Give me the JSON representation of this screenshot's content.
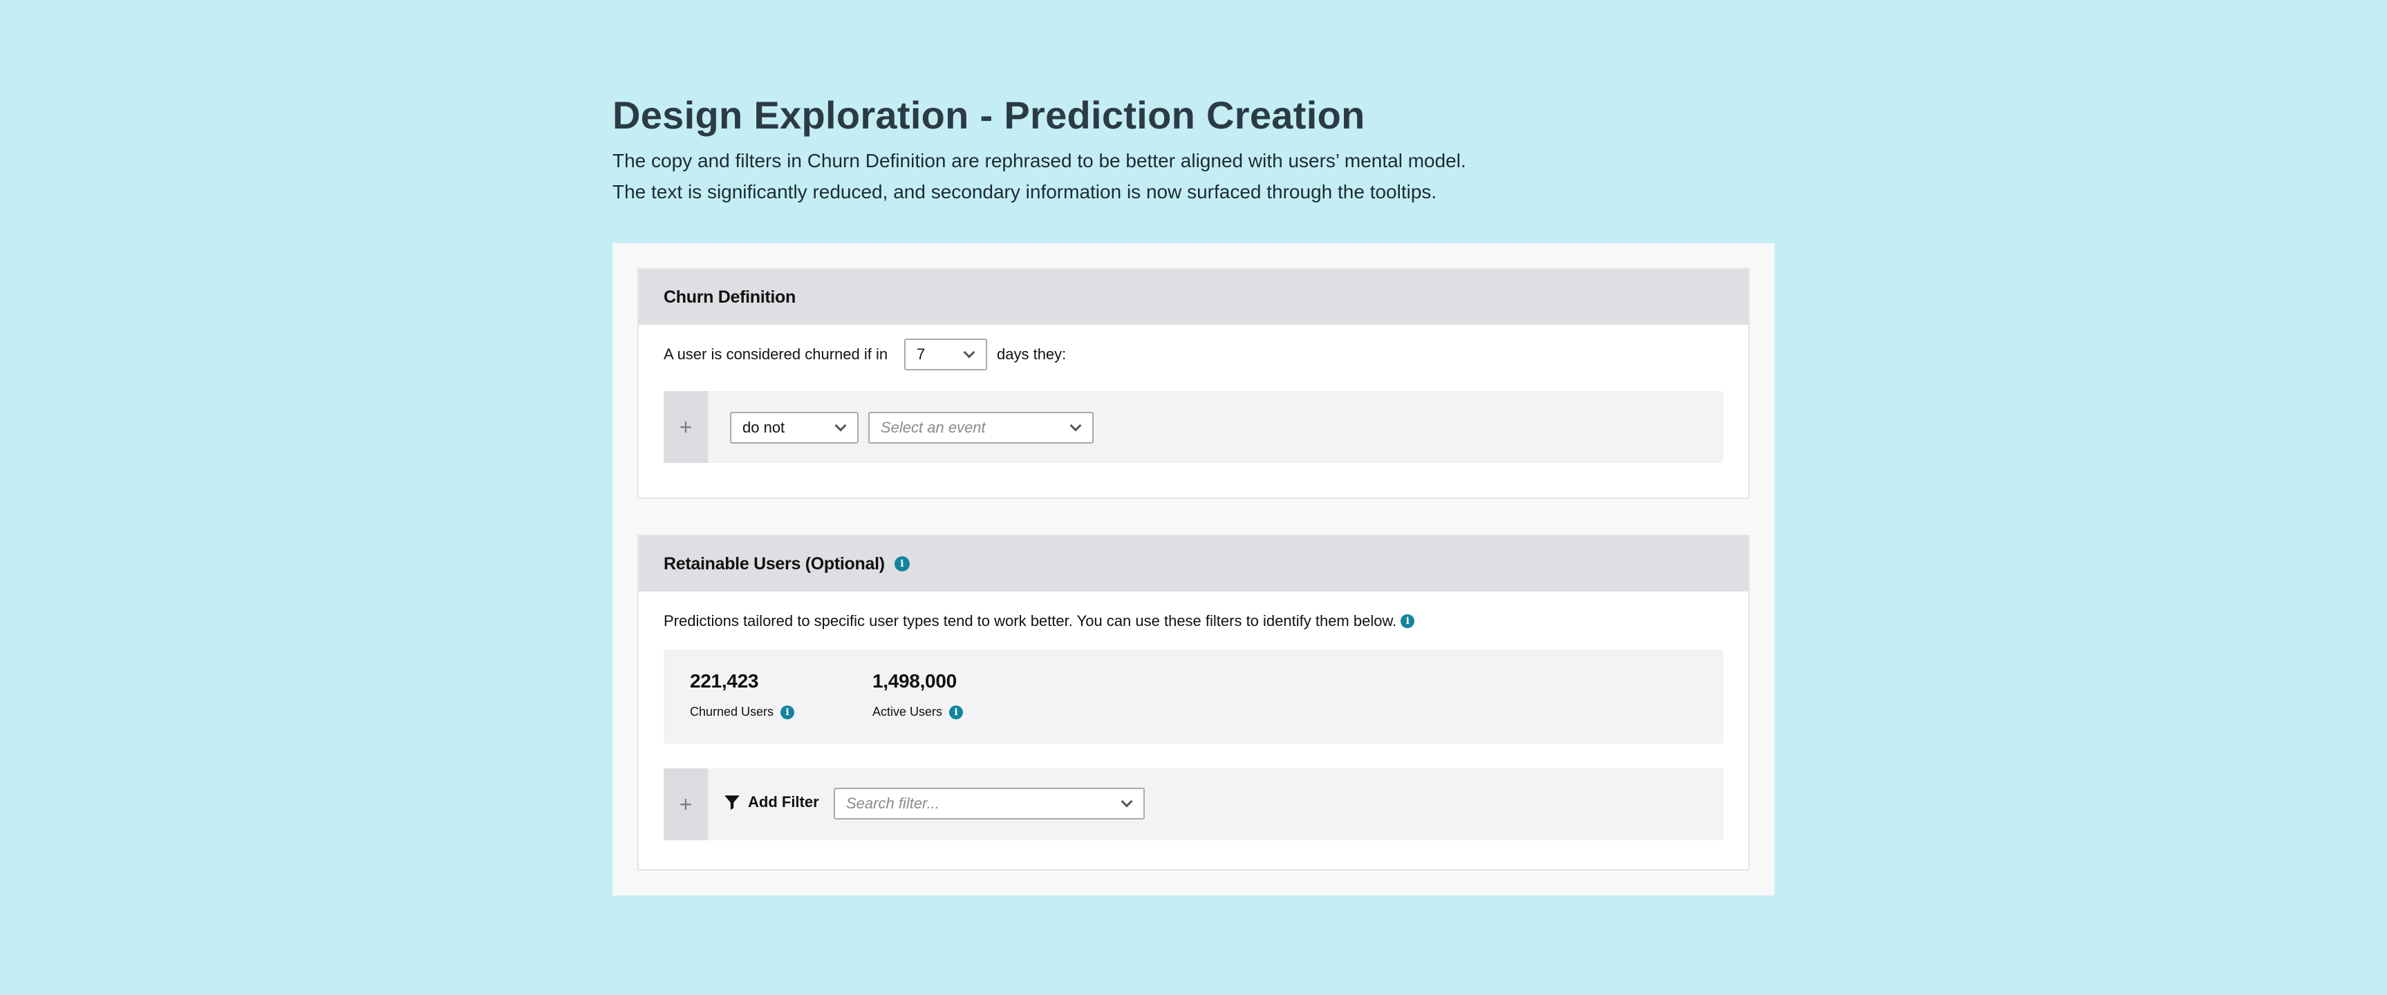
{
  "header": {
    "title": "Design Exploration - Prediction Creation",
    "subtitle_line1": "The copy and filters in Churn Definition are rephrased to be better aligned with users’ mental model.",
    "subtitle_line2": "The text is significantly reduced, and secondary information is now surfaced through the tooltips."
  },
  "churn": {
    "title": "Churn Definition",
    "sentence_prefix": "A user is considered churned if in",
    "days_value": "7",
    "sentence_suffix": "days they:",
    "add_symbol": "+",
    "condition_value": "do not",
    "event_placeholder": "Select an event"
  },
  "retainable": {
    "title": "Retainable Users (Optional)",
    "description": "Predictions tailored to specific user types tend to work better. You can use these filters to identify them below.",
    "stats": [
      {
        "value": "221,423",
        "label": "Churned Users"
      },
      {
        "value": "1,498,000",
        "label": "Active Users"
      }
    ],
    "add_symbol": "+",
    "add_filter_label": "Add Filter",
    "filter_placeholder": "Search filter..."
  },
  "icons": {
    "info": "info-icon",
    "chevron": "chevron-down-icon",
    "filter": "filter-funnel-icon",
    "add": "plus-icon"
  },
  "colors": {
    "background": "#c4eef4",
    "info_accent": "#14849c",
    "header_bg": "#dfdfe3",
    "title_text": "#2b3b45"
  }
}
